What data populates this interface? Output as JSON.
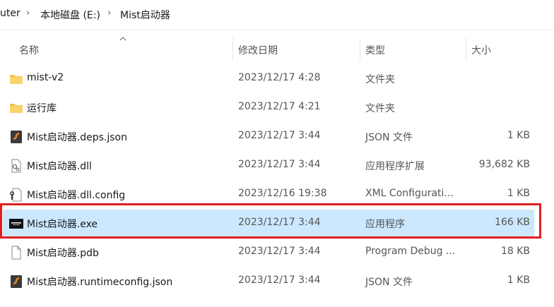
{
  "breadcrumb": {
    "items": [
      "uter",
      "本地磁盘 (E:)",
      "Mist启动器"
    ]
  },
  "columns": {
    "name": "名称",
    "date": "修改日期",
    "type": "类型",
    "size": "大小"
  },
  "files": [
    {
      "name": "mist-v2",
      "date": "2023/12/17 4:28",
      "type": "文件夹",
      "size": "",
      "icon": "folder-icon"
    },
    {
      "name": "运行库",
      "date": "2023/12/17 4:21",
      "type": "文件夹",
      "size": "",
      "icon": "folder-icon"
    },
    {
      "name": "Mist启动器.deps.json",
      "date": "2023/12/17 3:44",
      "type": "JSON 文件",
      "size": "1 KB",
      "icon": "json-file-icon"
    },
    {
      "name": "Mist启动器.dll",
      "date": "2023/12/17 3:44",
      "type": "应用程序扩展",
      "size": "93,682 KB",
      "icon": "dll-file-icon"
    },
    {
      "name": "Mist启动器.dll.config",
      "date": "2023/12/16 19:38",
      "type": "XML Configurati...",
      "size": "1 KB",
      "icon": "config-file-icon"
    },
    {
      "name": "Mist启动器.exe",
      "date": "2023/12/17 3:44",
      "type": "应用程序",
      "size": "166 KB",
      "icon": "exe-app-icon",
      "selected": true
    },
    {
      "name": "Mist启动器.pdb",
      "date": "2023/12/17 3:44",
      "type": "Program Debug ...",
      "size": "18 KB",
      "icon": "blank-file-icon"
    },
    {
      "name": "Mist启动器.runtimeconfig.json",
      "date": "2023/12/17 3:44",
      "type": "JSON 文件",
      "size": "1 KB",
      "icon": "json-file-icon"
    }
  ],
  "colors": {
    "selection": "#cce8ff",
    "highlight_border": "#e02020",
    "folder": "#f2c14e"
  }
}
